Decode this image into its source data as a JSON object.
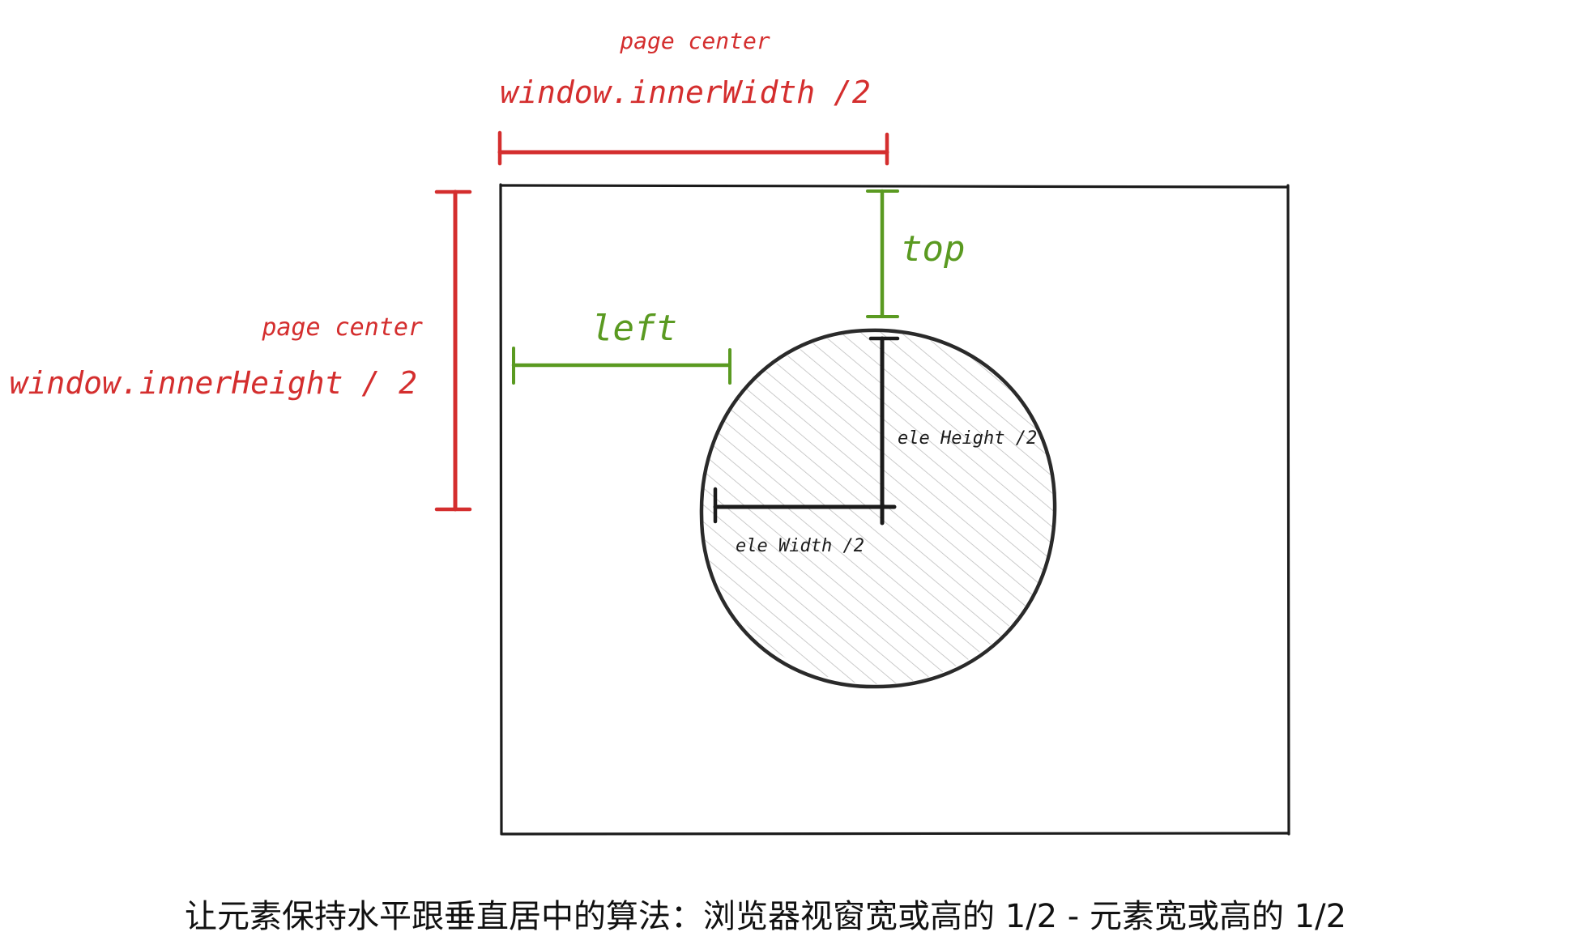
{
  "labels": {
    "top_page_center": "page center",
    "top_formula": "window.innerWidth /2",
    "left_page_center": "page center",
    "left_formula": "window.innerHeight / 2",
    "top": "top",
    "left": "left",
    "ele_height": "ele Height /2",
    "ele_width": "ele Width /2"
  },
  "caption": "让元素保持水平跟垂直居中的算法：浏览器视窗宽或高的 1/2 - 元素宽或高的 1/2",
  "colors": {
    "red": "#d42e2e",
    "green": "#5a9a21",
    "black": "#1b1b1b",
    "hatch": "#bdbdbd"
  }
}
